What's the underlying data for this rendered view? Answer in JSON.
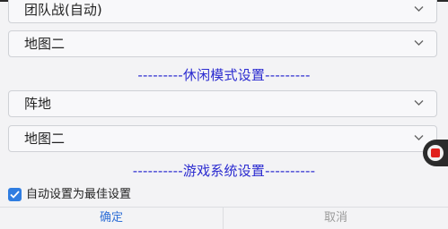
{
  "selects": [
    {
      "value": "团队战(自动)",
      "icon": "chevron-down-icon"
    },
    {
      "value": "地图二",
      "icon": "chevron-down-icon"
    },
    {
      "value": "阵地",
      "icon": "chevron-down-icon"
    },
    {
      "value": "地图二",
      "icon": "chevron-down-icon"
    }
  ],
  "sections": {
    "leisure": "---------休闲模式设置---------",
    "game_system": "----------游戏系统设置----------"
  },
  "checkbox": {
    "label": "自动设置为最佳设置",
    "checked": true,
    "color": "#2f7de1"
  },
  "footer": {
    "ok_label": "确定",
    "cancel_label": "取消"
  },
  "colors": {
    "section_title": "#2b2bd0",
    "ok": "#2f6fd6",
    "record": "#e0201b"
  }
}
